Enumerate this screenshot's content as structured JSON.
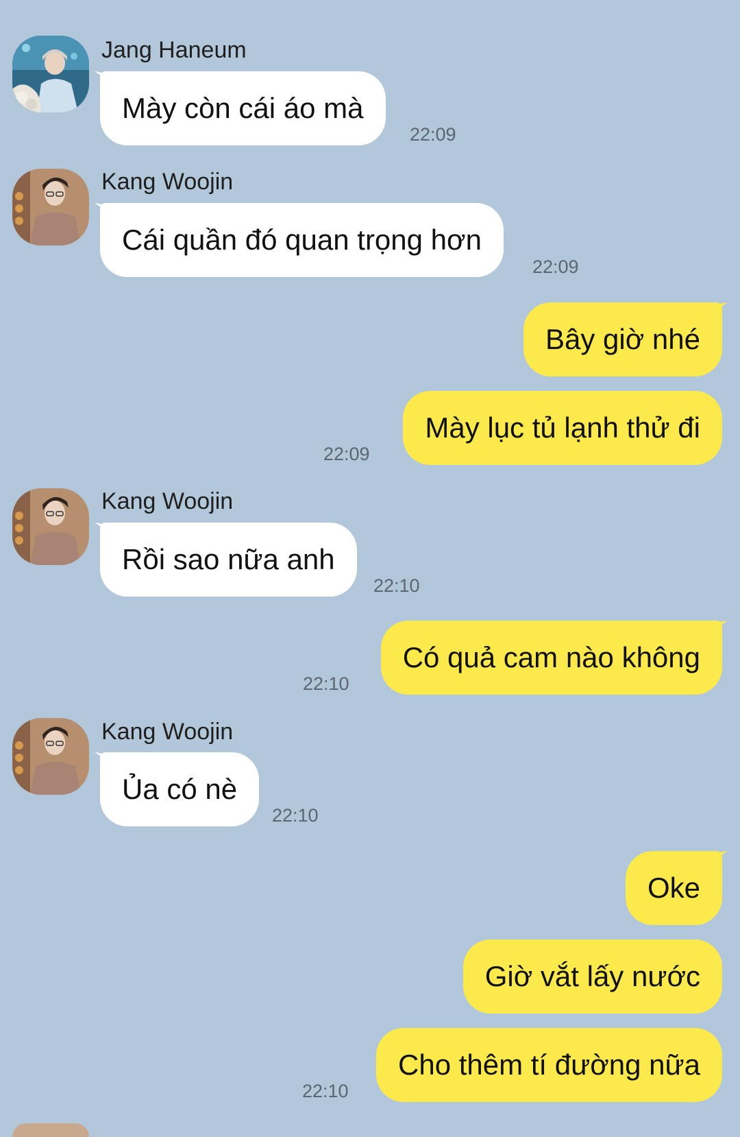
{
  "messages": [
    {
      "sender": "Jang Haneum",
      "text": "Mày còn cái áo mà",
      "time": "22:09"
    },
    {
      "sender": "Kang Woojin",
      "text": "Cái quần đó quan trọng hơn",
      "time": "22:09"
    },
    {
      "text": "Bây giờ nhé"
    },
    {
      "text": "Mày lục tủ lạnh thử đi",
      "time": "22:09"
    },
    {
      "sender": "Kang Woojin",
      "text": "Rồi sao nữa anh",
      "time": "22:10"
    },
    {
      "text": "Có quả cam nào không",
      "time": "22:10"
    },
    {
      "sender": "Kang Woojin",
      "text": "Ủa có nè",
      "time": "22:10"
    },
    {
      "text": "Oke"
    },
    {
      "text": "Giờ vắt lấy nước"
    },
    {
      "text": "Cho thêm tí đường nữa",
      "time": "22:10"
    }
  ],
  "colors": {
    "background": "#b2c7da",
    "incoming_bubble": "#ffffff",
    "outgoing_bubble": "#fce94b"
  },
  "icons": [
    "avatar-jang-haneum",
    "avatar-kang-woojin"
  ]
}
